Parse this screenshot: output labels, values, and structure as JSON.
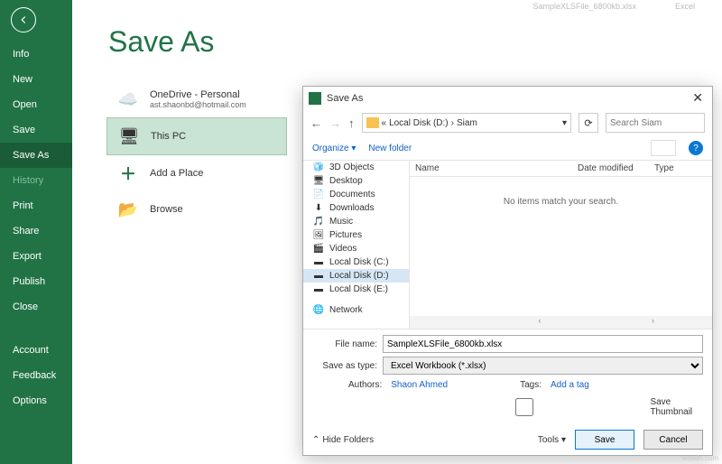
{
  "topbar": {
    "doc_hint": "SampleXLSFile_6800kb.xlsx",
    "signin": "Excel"
  },
  "page_title": "Save As",
  "sidebar": {
    "items": [
      "Info",
      "New",
      "Open",
      "Save",
      "Save As",
      "History",
      "Print",
      "Share",
      "Export",
      "Publish",
      "Close"
    ],
    "extra": [
      "Account",
      "Feedback",
      "Options"
    ],
    "selected_index": 4
  },
  "locations": {
    "onedrive": {
      "label": "OneDrive - Personal",
      "email": "ast.shaonbd@hotmail.com"
    },
    "thispc": {
      "label": "This PC"
    },
    "addplace": {
      "label": "Add a Place"
    },
    "browse": {
      "label": "Browse"
    },
    "selected": "thispc"
  },
  "dialog": {
    "title": "Save As",
    "breadcrumb": [
      "Local Disk (D:)",
      "Siam"
    ],
    "search_placeholder": "Search Siam",
    "toolbar": {
      "organize": "Organize",
      "newfolder": "New folder"
    },
    "tree": [
      {
        "icon": "🧊",
        "label": "3D Objects"
      },
      {
        "icon": "🖥",
        "label": "Desktop"
      },
      {
        "icon": "📄",
        "label": "Documents"
      },
      {
        "icon": "⬇",
        "label": "Downloads"
      },
      {
        "icon": "🎵",
        "label": "Music"
      },
      {
        "icon": "🖼",
        "label": "Pictures"
      },
      {
        "icon": "🎬",
        "label": "Videos"
      },
      {
        "icon": "▬",
        "label": "Local Disk (C:)"
      },
      {
        "icon": "▬",
        "label": "Local Disk (D:)",
        "selected": true
      },
      {
        "icon": "▬",
        "label": "Local Disk (E:)"
      },
      {
        "icon": "🌐",
        "label": "Network",
        "net": true
      }
    ],
    "columns": [
      "Name",
      "Date modified",
      "Type"
    ],
    "empty_msg": "No items match your search.",
    "filename_label": "File name:",
    "filename_value": "SampleXLSFile_6800kb.xlsx",
    "savetype_label": "Save as type:",
    "savetype_value": "Excel Workbook (*.xlsx)",
    "authors_label": "Authors:",
    "authors_value": "Shaon Ahmed",
    "tags_label": "Tags:",
    "tags_value": "Add a tag",
    "thumb_label": "Save Thumbnail",
    "hide_folders": "Hide Folders",
    "tools": "Tools",
    "save": "Save",
    "cancel": "Cancel"
  },
  "watermark": "wsxdn.com"
}
